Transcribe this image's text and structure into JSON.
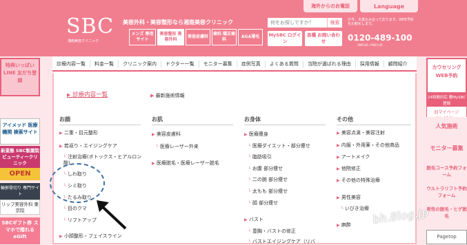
{
  "header": {
    "tagline": "美容外科・美容整形なら湘南美容クリニック",
    "logo": "SBC",
    "logo_sub": "湘南美容クリニック",
    "abroad": "海外からのお電話",
    "language": "Language",
    "search_placeholder": "何をお探しですか？",
    "search_btn": "検索",
    "tel_note": "只今、大変込み合っております。WEB予約をお勧めします。",
    "tel": "0120-489-100",
    "tel_sub": "AM9:00〜PM21:00",
    "mysbc": "MySBC ログイン",
    "contact": "各種 お問い合わせ",
    "topnav": [
      {
        "label": "メンズ 専用サイト"
      },
      {
        "label": "美容整形 美容外科"
      },
      {
        "label": "美容皮膚科"
      },
      {
        "label": "歯科 矯正歯科"
      },
      {
        "label": "AGA薄毛"
      }
    ]
  },
  "gnav": [
    "診療内容一覧",
    "料金一覧",
    "クリニック案内",
    "ドクター一覧",
    "モニター募集",
    "症例写真",
    "よくある質問",
    "当院が選ばれる理由",
    "採用情報",
    "顧問紹介"
  ],
  "main": {
    "title": "診療内容一覧",
    "latest": "最新施術情報"
  },
  "cols": [
    {
      "head": "お顔",
      "items": [
        "二重・目元整形",
        "若返り・エイジングケア",
        "注射治療(ボトックス・ヒアルロン酸)",
        "しわ取り",
        "シミ取り",
        "たるみ取り",
        "目のクマ",
        "リフトアップ",
        "小顔整形・フェイスライン"
      ]
    },
    {
      "head": "お肌",
      "items": [
        "美容皮膚科",
        "医療レーザー外来",
        "医療脱毛・医療レーザー脱毛"
      ]
    },
    {
      "head": "お身体",
      "items": [
        "医療痩身",
        "医療ダイエット・部分痩せ",
        "脂肪吸引",
        "お腹 部分痩せ",
        "二の腕 部分痩せ",
        "太もも 部分痩せ",
        "顔 部分痩せ",
        "バスト",
        "豊胸・バストの修正",
        "バストエイジングケア（リバ"
      ]
    },
    {
      "head": "その他",
      "items": [
        "美容点滴・美容注射",
        "内服・外用薬・その他商品",
        "アートメイク",
        "他院修正",
        "その他の特殊治療",
        "男性美容",
        "いびき治療",
        "麻酔"
      ]
    }
  ],
  "left": [
    "特典いっぱい LINE 友だち登録",
    "アイメッド 医療機関 検索サイト",
    "新業態 SBC製薬院 ビューティークリニック",
    "OPEN",
    "輪郭骨切り 専門サイト",
    "リップ美容外科 東京院",
    "SBCギフト券 スマホで贈れる eGift"
  ],
  "right": [
    "カウセリング WEB予約",
    "24時間対応 要MySBC登録",
    "旧マイページ (MySBC)へ",
    "人気施術",
    "モニター募集",
    "脱毛コース予約フォーム",
    "ウルトラリフト予約フォーム",
    "男性の脱毛・ヒゲ脱毛",
    "Pagetop"
  ],
  "watermark": "bh.8log.jp"
}
